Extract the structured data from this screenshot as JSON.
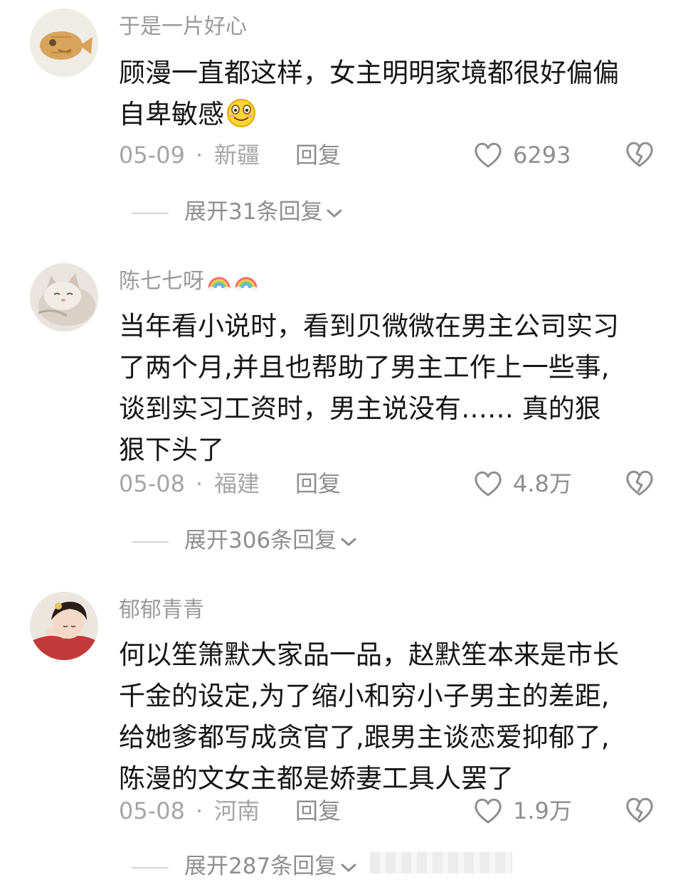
{
  "colors": {
    "background": "#ffffff",
    "username": "#9a9a9a",
    "text": "#161616",
    "meta": "#a5a5a5",
    "icon": "#8e8e8e"
  },
  "comments": [
    {
      "username": "于是一片好心",
      "text_lines": [
        "顾漫一直都这样，女主明明家境都很好偏偏",
        "自卑敏感"
      ],
      "trailing_emoji": "smile-emoji",
      "date": "05-09",
      "separator": "·",
      "region": "新疆",
      "reply_label": "回复",
      "like_count": "6293",
      "expand_label": "展开31条回复"
    },
    {
      "username": "陈七七呀",
      "username_emoji": [
        "rainbow-emoji",
        "rainbow-emoji"
      ],
      "text_lines": [
        "当年看小说时，看到贝微微在男主公司实习",
        "了两个月,并且也帮助了男主工作上一些事,",
        "谈到实习工资时，男主说没有…… 真的狠",
        "狠下头了"
      ],
      "date": "05-08",
      "separator": "·",
      "region": "福建",
      "reply_label": "回复",
      "like_count": "4.8万",
      "expand_label": "展开306条回复"
    },
    {
      "username": "郁郁青青",
      "text_lines": [
        "何以笙箫默大家品一品，赵默笙本来是市长",
        "千金的设定,为了缩小和穷小子男主的差距,",
        "给她爹都写成贪官了,跟男主谈恋爱抑郁了,",
        "陈漫的文女主都是娇妻工具人罢了"
      ],
      "date": "05-08",
      "separator": "·",
      "region": "河南",
      "reply_label": "回复",
      "like_count": "1.9万",
      "expand_label": "展开287条回复"
    }
  ]
}
